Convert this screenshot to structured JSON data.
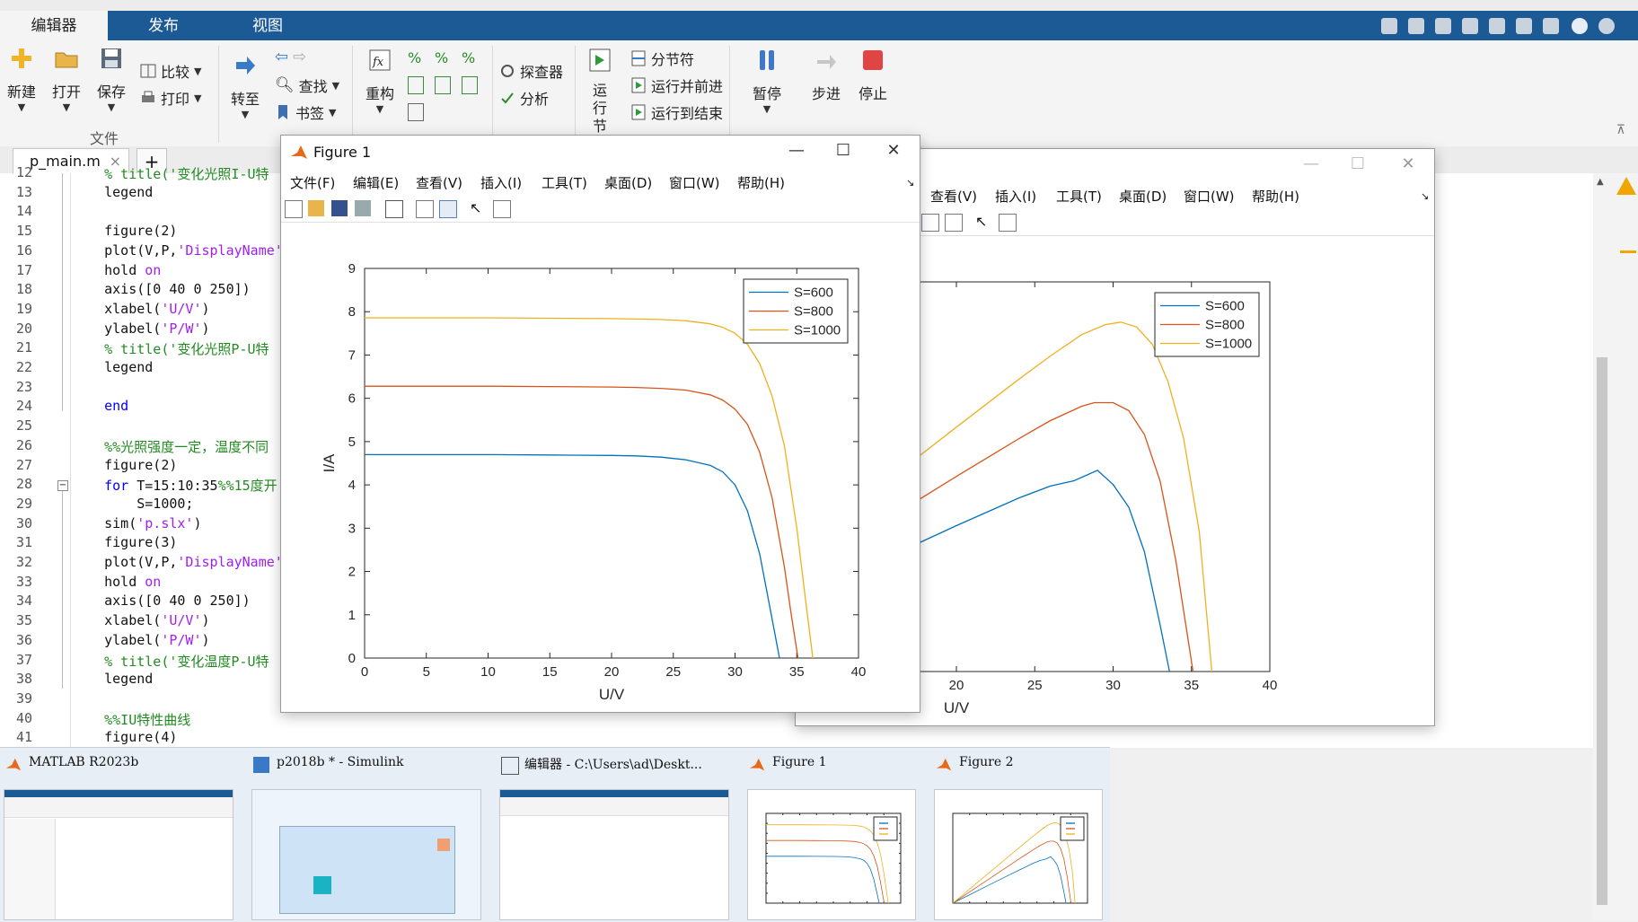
{
  "ribbon": {
    "tabs": [
      "编辑器",
      "发布",
      "视图"
    ],
    "buttons": {
      "new": "新建",
      "open": "打开",
      "save": "保存",
      "compare": "比较",
      "print": "打印",
      "goto": "转至",
      "find": "查找",
      "bookmark": "书签",
      "refactor": "重构",
      "inspector": "探查器",
      "analyze": "分析",
      "run_section": "运行节",
      "section_break": "分节符",
      "run_advance": "运行并前进",
      "run_to_end": "运行到结束",
      "pause": "暂停",
      "step": "步进",
      "stop": "停止"
    },
    "groups": {
      "file": "文件"
    }
  },
  "editor": {
    "tab_label": "p_main.m",
    "lines": [
      {
        "n": "12",
        "code": [
          {
            "t": "    % title('变化光照I-U特",
            "c": "cm"
          }
        ]
      },
      {
        "n": "13",
        "code": [
          {
            "t": "    legend",
            "c": ""
          }
        ]
      },
      {
        "n": "14",
        "code": []
      },
      {
        "n": "15",
        "code": [
          {
            "t": "    figure(2)",
            "c": ""
          }
        ]
      },
      {
        "n": "16",
        "code": [
          {
            "t": "    plot(V,P,",
            "c": ""
          },
          {
            "t": "'DisplayName'",
            "c": "str"
          }
        ]
      },
      {
        "n": "17",
        "code": [
          {
            "t": "    hold ",
            "c": ""
          },
          {
            "t": "on",
            "c": "str"
          }
        ]
      },
      {
        "n": "18",
        "code": [
          {
            "t": "    axis([0 40 0 250])",
            "c": ""
          }
        ]
      },
      {
        "n": "19",
        "code": [
          {
            "t": "    xlabel(",
            "c": ""
          },
          {
            "t": "'U/V'",
            "c": "str"
          },
          {
            "t": ")",
            "c": ""
          }
        ]
      },
      {
        "n": "20",
        "code": [
          {
            "t": "    ylabel(",
            "c": ""
          },
          {
            "t": "'P/W'",
            "c": "str"
          },
          {
            "t": ")",
            "c": ""
          }
        ]
      },
      {
        "n": "21",
        "code": [
          {
            "t": "    % title('变化光照P-U特",
            "c": "cm"
          }
        ]
      },
      {
        "n": "22",
        "code": [
          {
            "t": "    legend",
            "c": ""
          }
        ]
      },
      {
        "n": "23",
        "code": []
      },
      {
        "n": "24",
        "code": [
          {
            "t": "    end",
            "c": "kw"
          }
        ]
      },
      {
        "n": "25",
        "code": []
      },
      {
        "n": "26",
        "code": [
          {
            "t": "    %%光照强度一定，温度不同",
            "c": "cm"
          }
        ]
      },
      {
        "n": "27",
        "code": [
          {
            "t": "    figure(2)",
            "c": ""
          }
        ]
      },
      {
        "n": "28",
        "code": [
          {
            "t": "    for ",
            "c": "kw"
          },
          {
            "t": "T=15:10:35",
            "c": ""
          },
          {
            "t": "%%15度开:",
            "c": "cm"
          }
        ]
      },
      {
        "n": "29",
        "code": [
          {
            "t": "        S=1000;",
            "c": ""
          }
        ]
      },
      {
        "n": "30",
        "code": [
          {
            "t": "    sim(",
            "c": ""
          },
          {
            "t": "'p.slx'",
            "c": "str"
          },
          {
            "t": ")",
            "c": ""
          }
        ]
      },
      {
        "n": "31",
        "code": [
          {
            "t": "    figure(3)",
            "c": ""
          }
        ]
      },
      {
        "n": "32",
        "code": [
          {
            "t": "    plot(V,P,",
            "c": ""
          },
          {
            "t": "'DisplayName'",
            "c": "str"
          }
        ]
      },
      {
        "n": "33",
        "code": [
          {
            "t": "    hold ",
            "c": ""
          },
          {
            "t": "on",
            "c": "str"
          }
        ]
      },
      {
        "n": "34",
        "code": [
          {
            "t": "    axis([0 40 0 250])",
            "c": ""
          }
        ]
      },
      {
        "n": "35",
        "code": [
          {
            "t": "    xlabel(",
            "c": ""
          },
          {
            "t": "'U/V'",
            "c": "str"
          },
          {
            "t": ")",
            "c": ""
          }
        ]
      },
      {
        "n": "36",
        "code": [
          {
            "t": "    ylabel(",
            "c": ""
          },
          {
            "t": "'P/W'",
            "c": "str"
          },
          {
            "t": ")",
            "c": ""
          }
        ]
      },
      {
        "n": "37",
        "code": [
          {
            "t": "    % title('变化温度P-U特",
            "c": "cm"
          }
        ]
      },
      {
        "n": "38",
        "code": [
          {
            "t": "    legend",
            "c": ""
          }
        ]
      },
      {
        "n": "39",
        "code": []
      },
      {
        "n": "40",
        "code": [
          {
            "t": "    %%IU特性曲线",
            "c": "cm"
          }
        ]
      },
      {
        "n": "41",
        "code": [
          {
            "t": "    figure(4)",
            "c": ""
          }
        ]
      }
    ]
  },
  "figure1": {
    "title": "Figure 1",
    "menu": [
      "文件(F)",
      "编辑(E)",
      "查看(V)",
      "插入(I)",
      "工具(T)",
      "桌面(D)",
      "窗口(W)",
      "帮助(H)"
    ]
  },
  "figure2": {
    "menu": [
      "查看(V)",
      "插入(I)",
      "工具(T)",
      "桌面(D)",
      "窗口(W)",
      "帮助(H)"
    ]
  },
  "chart_data": [
    {
      "type": "line",
      "xlabel": "U/V",
      "ylabel": "I/A",
      "xlim": [
        0,
        40
      ],
      "ylim": [
        0,
        9
      ],
      "xticks": [
        0,
        5,
        10,
        15,
        20,
        25,
        30,
        35,
        40
      ],
      "yticks": [
        0,
        1,
        2,
        3,
        4,
        5,
        6,
        7,
        8,
        9
      ],
      "legend_position": "top-right",
      "series": [
        {
          "name": "S=600",
          "color": "#0072bd",
          "x": [
            0,
            5,
            10,
            15,
            20,
            22,
            24,
            26,
            28,
            29,
            30,
            31,
            32,
            33,
            33.6
          ],
          "y": [
            4.7,
            4.7,
            4.7,
            4.69,
            4.68,
            4.67,
            4.64,
            4.58,
            4.45,
            4.3,
            4.0,
            3.4,
            2.4,
            0.9,
            0
          ]
        },
        {
          "name": "S=800",
          "color": "#d95319",
          "x": [
            0,
            5,
            10,
            15,
            20,
            22,
            24,
            26,
            28,
            29,
            30,
            31,
            32,
            33,
            34,
            34.5,
            35.1
          ],
          "y": [
            6.28,
            6.28,
            6.28,
            6.27,
            6.26,
            6.25,
            6.23,
            6.19,
            6.08,
            5.96,
            5.75,
            5.4,
            4.75,
            3.7,
            2.1,
            1.1,
            0
          ]
        },
        {
          "name": "S=1000",
          "color": "#edb120",
          "x": [
            0,
            5,
            10,
            15,
            20,
            24,
            26,
            28,
            29,
            30,
            31,
            32,
            33,
            34,
            35,
            35.6,
            36.3
          ],
          "y": [
            7.86,
            7.86,
            7.86,
            7.85,
            7.84,
            7.82,
            7.79,
            7.72,
            7.64,
            7.5,
            7.25,
            6.8,
            6.05,
            4.9,
            3.0,
            1.6,
            0
          ]
        }
      ]
    },
    {
      "type": "line",
      "xlabel": "U/V",
      "xlim": [
        0,
        40
      ],
      "ylim": [
        0,
        250
      ],
      "xticks": [
        5,
        10,
        15,
        20,
        25,
        30,
        35,
        40
      ],
      "legend_position": "top-right",
      "series": [
        {
          "name": "S=600",
          "color": "#0072bd",
          "x": [
            0,
            5,
            10,
            15,
            20,
            24,
            26,
            27.5,
            29,
            30,
            31,
            32,
            33,
            33.6
          ],
          "y": [
            0,
            23.5,
            47,
            70.4,
            93.6,
            111.4,
            119,
            122.4,
            129.1,
            120,
            105.4,
            76.8,
            29.7,
            0
          ]
        },
        {
          "name": "S=800",
          "color": "#d95319",
          "x": [
            0,
            5,
            10,
            15,
            20,
            24,
            26,
            28,
            28.8,
            30,
            31,
            32,
            33,
            34,
            35.1
          ],
          "y": [
            0,
            31.4,
            62.8,
            94.1,
            125.2,
            149.5,
            161,
            170.2,
            172.5,
            172.5,
            167.4,
            152,
            122.1,
            71.4,
            0
          ]
        },
        {
          "name": "S=1000",
          "color": "#edb120",
          "x": [
            0,
            5,
            10,
            15,
            20,
            24,
            26,
            28,
            29.5,
            30.5,
            31.5,
            32.5,
            33.5,
            34.5,
            35.5,
            36.3
          ],
          "y": [
            0,
            39.3,
            78.6,
            117.8,
            156.8,
            187.7,
            202.5,
            216.2,
            222.6,
            224.2,
            221,
            210,
            186,
            149.7,
            89.5,
            0
          ]
        }
      ]
    }
  ],
  "taskbar": {
    "items": [
      "MATLAB R2023b",
      "p2018b * - Simulink",
      "编辑器 - C:\\Users\\ad\\Deskt...",
      "Figure 1",
      "Figure 2"
    ]
  }
}
